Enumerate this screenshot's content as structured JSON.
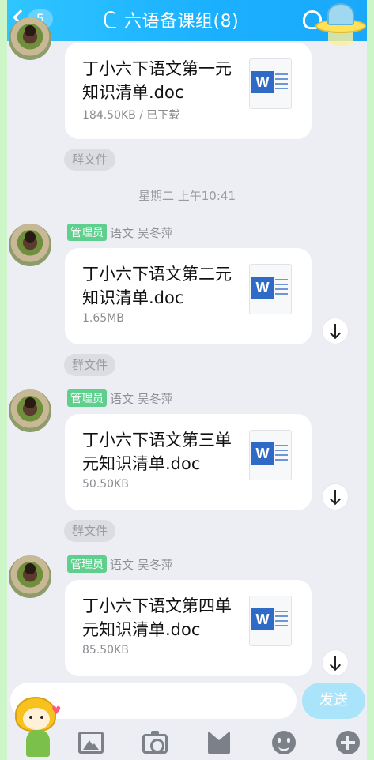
{
  "header": {
    "back_count": "5",
    "title": "六语备课组(8)"
  },
  "timestamp": "星期二 上午10:41",
  "system_label": "群文件",
  "messages": [
    {
      "file_name": "丁小六下语文第一元知识清单.doc",
      "file_size": "184.50KB / 已下载",
      "file_icon": "word-doc-icon"
    },
    {
      "role": "管理员",
      "sender": "语文 吴冬萍",
      "file_name": "丁小六下语文第二元知识清单.doc",
      "file_size": "1.65MB",
      "file_icon": "word-doc-icon",
      "action_icon": "download-icon"
    },
    {
      "role": "管理员",
      "sender": "语文 吴冬萍",
      "file_name": "丁小六下语文第三单元知识清单.doc",
      "file_size": "50.50KB",
      "file_icon": "word-doc-icon",
      "action_icon": "download-icon"
    },
    {
      "role": "管理员",
      "sender": "语文 吴冬萍",
      "file_name": "丁小六下语文第四单元知识清单.doc",
      "file_size": "85.50KB",
      "file_icon": "word-doc-icon",
      "action_icon": "download-icon"
    }
  ],
  "input": {
    "value": "",
    "send_label": "发送"
  },
  "toolbar": [
    "image-icon",
    "camera-icon",
    "red-packet-icon",
    "emoji-icon",
    "plus-icon"
  ],
  "colors": {
    "header": "#1bb1ff",
    "admin_badge": "#5fcf8e",
    "send_button": "#a9e4fa",
    "word_icon": "#2f6bc6"
  }
}
